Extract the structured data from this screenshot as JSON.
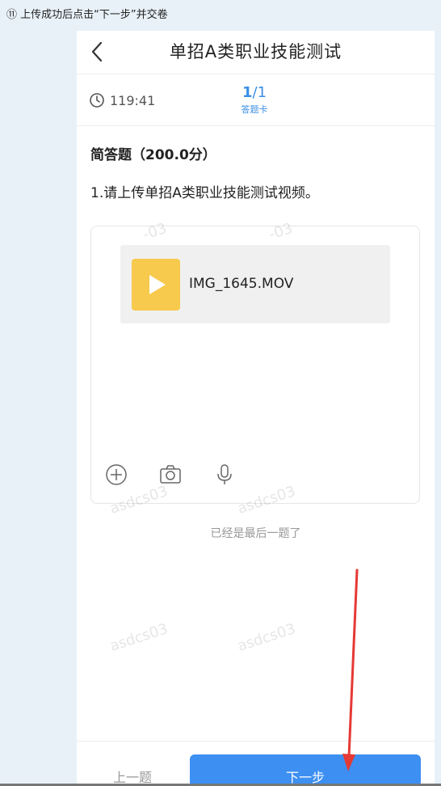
{
  "caption": "⑪ 上传成功后点击“下一步”并交卷",
  "header": {
    "title": "单招A类职业技能测试"
  },
  "status": {
    "timer": "119:41",
    "page_current": "1",
    "page_total": "/1",
    "answer_card_label": "答题卡"
  },
  "question": {
    "type_label": "简答题（200.0分）",
    "text": "1.请上传单招A类职业技能测试视频。"
  },
  "attachment": {
    "file_name": "IMG_1645.MOV"
  },
  "tools": [
    "plus-icon",
    "camera-icon",
    "microphone-icon"
  ],
  "hint": "已经是最后一题了",
  "footer": {
    "prev_label": "上一题",
    "next_label": "下一步"
  },
  "watermark_text": "asdcs03",
  "watermark_fragment": "-03",
  "colors": {
    "accent": "#3d8ff2",
    "file_thumb": "#f7c94c",
    "annotation_arrow": "#e53935"
  }
}
